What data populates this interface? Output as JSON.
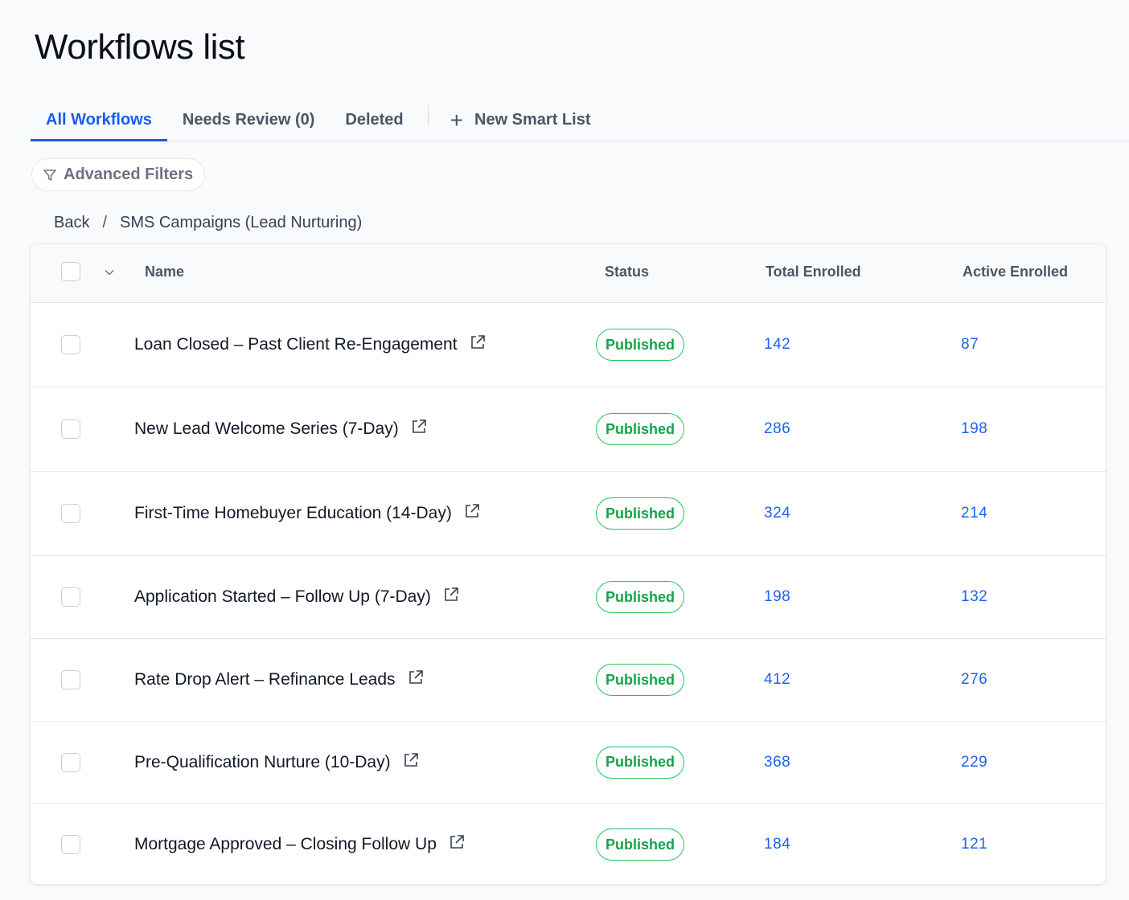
{
  "page": {
    "title": "Workflows list"
  },
  "tabs": [
    {
      "label": "All Workflows",
      "active": true
    },
    {
      "label": "Needs Review (0)",
      "active": false
    },
    {
      "label": "Deleted",
      "active": false
    }
  ],
  "new_smart_list": {
    "icon": "plus-icon",
    "label": "New Smart List"
  },
  "filters": {
    "icon": "filter-icon",
    "label": "Advanced Filters"
  },
  "breadcrumb": {
    "back": "Back",
    "separator": "/",
    "current": "SMS Campaigns (Lead Nurturing)"
  },
  "table": {
    "columns": {
      "name": "Name",
      "status": "Status",
      "total_enrolled": "Total Enrolled",
      "active_enrolled": "Active Enrolled"
    },
    "rows": [
      {
        "name": "Loan Closed – Past Client Re-Engagement",
        "status": "Published",
        "total": "142",
        "active": "87"
      },
      {
        "name": "New Lead Welcome Series (7-Day)",
        "status": "Published",
        "total": "286",
        "active": "198"
      },
      {
        "name": "First-Time Homebuyer Education (14-Day)",
        "status": "Published",
        "total": "324",
        "active": "214"
      },
      {
        "name": "Application Started – Follow Up (7-Day)",
        "status": "Published",
        "total": "198",
        "active": "132"
      },
      {
        "name": "Rate Drop Alert – Refinance Leads",
        "status": "Published",
        "total": "412",
        "active": "276"
      },
      {
        "name": "Pre-Qualification Nurture (10-Day)",
        "status": "Published",
        "total": "368",
        "active": "229"
      },
      {
        "name": "Mortgage Approved – Closing Follow Up",
        "status": "Published",
        "total": "184",
        "active": "121"
      }
    ]
  },
  "colors": {
    "accent": "#155eef",
    "link_number": "#1d63ed",
    "status_published": "#16a34a",
    "status_border": "#22c55e"
  }
}
